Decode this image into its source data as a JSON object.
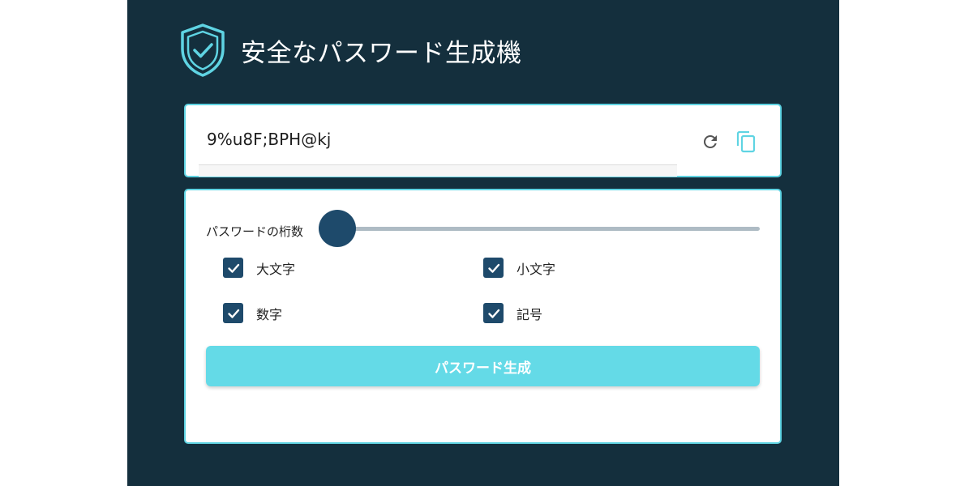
{
  "header": {
    "title": "安全なパスワード生成機",
    "icon": "shield-check-icon"
  },
  "password": {
    "value": "9%u8F;BPH@kj",
    "refresh_icon": "refresh-icon",
    "copy_icon": "copy-icon"
  },
  "options": {
    "length_label": "パスワードの桁数",
    "checkboxes": [
      {
        "label": "大文字",
        "checked": true
      },
      {
        "label": "小文字",
        "checked": true
      },
      {
        "label": "数字",
        "checked": true
      },
      {
        "label": "記号",
        "checked": true
      }
    ],
    "generate_label": "パスワード生成"
  },
  "colors": {
    "background": "#142f3d",
    "accent": "#5fd4e3",
    "button": "#64dae7",
    "checkbox": "#1e4a6b"
  }
}
